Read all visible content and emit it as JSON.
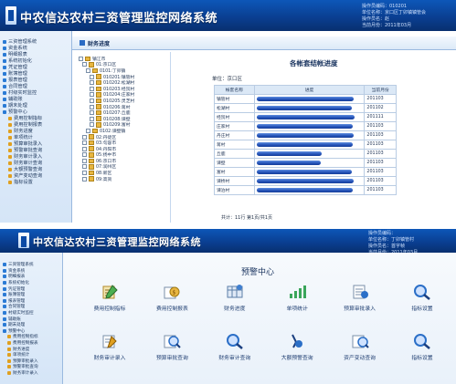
{
  "top": {
    "title": "中农信达农村三资管理监控网络系统",
    "info": [
      "操作员编码：010201",
      "单位名称：京口区丁卯镇镇管会",
      "操作员名：赵",
      "当前月份：2011年03月"
    ],
    "sidebar": [
      "三资管理系统",
      "资金系统",
      "明细报表",
      "系统初始化",
      "凭证管理",
      "账簿管理",
      "报表管理",
      "合同管理",
      "村级实时监控",
      "辅助账",
      "期末处理",
      "预警中心"
    ],
    "sidebar_sub": [
      "费用控制指标",
      "费用控制报表",
      "财务进度",
      "单项统计",
      "预算审批录入",
      "预警审批查询",
      "财务审计录入",
      "财务审计查询",
      "大额预警查询",
      "资产变动查询",
      "指标设置"
    ],
    "tab_label": "财务进度",
    "tree": [
      "镇江市",
      "01:京口区",
      "0101:丁卯镇",
      "010201:镇管村",
      "010202:松湖村",
      "010203:经贸村",
      "010204:庄家村",
      "010205:灵芝村",
      "010206:蒋村",
      "010207:丘鹿",
      "010208:谏壁",
      "010209:富村",
      "0102:谏壁镇",
      "02:丹徒区",
      "03:句容市",
      "04:丹阳市",
      "05:扬中市",
      "06:京口市",
      "07:润州区",
      "08:新区",
      "09:高资"
    ],
    "report_title": "各帐套结帐进度",
    "unit_label": "单位：京口区",
    "table_headers": [
      "帐套名称",
      "进度",
      "当前月份"
    ],
    "rows": [
      {
        "name": "镇管村",
        "month": "201103",
        "progress": 0.92
      },
      {
        "name": "松湖村",
        "month": "201102",
        "progress": 0.9
      },
      {
        "name": "经贸村",
        "month": "201111",
        "progress": 0.93
      },
      {
        "name": "庄家村",
        "month": "201103",
        "progress": 0.91
      },
      {
        "name": "丹庄村",
        "month": "201103",
        "progress": 0.92
      },
      {
        "name": "蒋村",
        "month": "201103",
        "progress": 0.91
      },
      {
        "name": "丘鹿",
        "month": "201103",
        "progress": 0.62
      },
      {
        "name": "谏壁",
        "month": "201103",
        "progress": 0.61
      },
      {
        "name": "富村",
        "month": "201103",
        "progress": 0.9
      },
      {
        "name": "谏桥村",
        "month": "201103",
        "progress": 0.92
      },
      {
        "name": "谏泊村",
        "month": "201103",
        "progress": 0.91
      }
    ],
    "footer": "共计：11行    第1页/共1页"
  },
  "bottom": {
    "title": "中农信达农村三资管理监控网络系统",
    "info": [
      "操作员编码：",
      "单位名称：丁卯镇管村",
      "操作员名：首字帧",
      "当前月份：2011年03月"
    ],
    "sidebar": [
      "三资管理系统",
      "资金系统",
      "明细报表",
      "系统初始化",
      "凭证管理",
      "账簿管理",
      "报表管理",
      "合同管理",
      "村级实时监控",
      "辅助账",
      "期末处理",
      "预警中心"
    ],
    "sidebar_sub": [
      "费用控制指标",
      "费用控制报表",
      "财务进度",
      "单项统计",
      "预算审批录入",
      "预警审批查询",
      "财务审计录入"
    ],
    "center_title": "预警中心",
    "tiles_row1": [
      "费用控制指标",
      "费用控制报表",
      "财务进度",
      "单项统计",
      "预算审批录入",
      "指标设置"
    ],
    "tiles_row2": [
      "财务审计录入",
      "预算审批查询",
      "财务审计查询",
      "大额预警查询",
      "资产变动查询",
      "指标设置"
    ]
  },
  "colors": {
    "banner": "#0b4aa5",
    "bar": "#2250b6",
    "sidebar": "#dbe8f6"
  }
}
